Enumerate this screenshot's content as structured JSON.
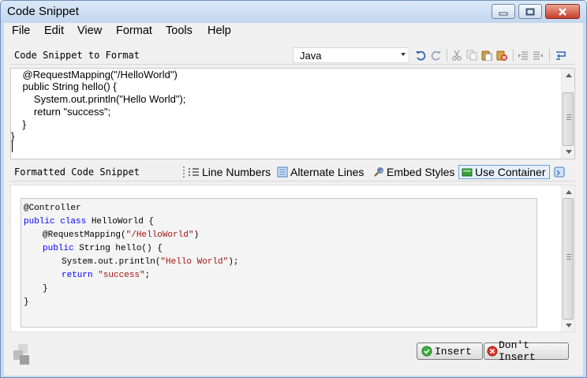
{
  "window": {
    "title": "Code Snippet"
  },
  "menu": [
    "File",
    "Edit",
    "View",
    "Format",
    "Tools",
    "Help"
  ],
  "source_panel": {
    "label": "Code Snippet to Format",
    "language": "Java",
    "lines": [
      "    @RequestMapping(\"/HelloWorld\")",
      "    public String hello() {",
      "        System.out.println(\"Hello World\");",
      "        return \"success\";",
      "    }",
      "}"
    ]
  },
  "format_panel": {
    "label": "Formatted Code Snippet",
    "options": {
      "line_numbers": "Line Numbers",
      "alternate_lines": "Alternate Lines",
      "embed_styles": "Embed Styles",
      "use_container": "Use Container"
    }
  },
  "preview": {
    "l1": "@Controller",
    "l2_kw": "public class",
    "l2_rest": " HelloWorld {",
    "l3_pre": "@RequestMapping(",
    "l3_str": "\"/HelloWorld\"",
    "l3_post": ")",
    "l4_kw": "public",
    "l4_rest": " String hello() {",
    "l5_pre": "System.out.println(",
    "l5_str": "\"Hello World\"",
    "l5_post": ");",
    "l6_kw": "return",
    "l6_str": "\"success\"",
    "l6_post": ";",
    "l7": "}",
    "l8": "}"
  },
  "buttons": {
    "insert": "Insert",
    "dont_insert": "Don't Insert"
  },
  "colors": {
    "keyword": "#0000ff",
    "string": "#a31515",
    "accent": "#6ea2d8"
  }
}
